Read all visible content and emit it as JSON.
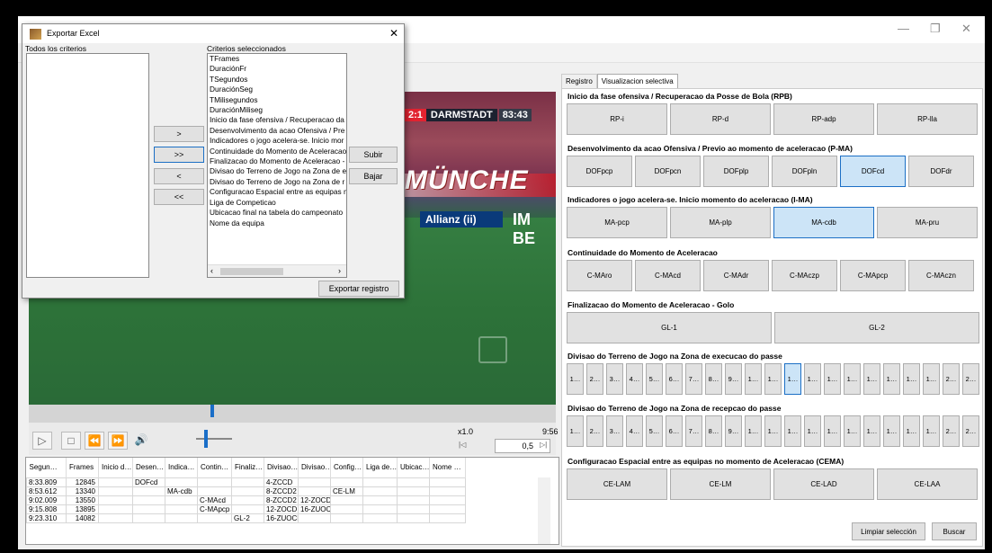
{
  "window": {
    "min_glyph": "—",
    "restore_glyph": "❐",
    "close_glyph": "✕"
  },
  "video": {
    "score": "2:1",
    "team": "DARMSTADT",
    "clock": "83:43",
    "banner": "MÜNCHE",
    "sponsor": "Allianz (ii)",
    "banner2": "IM BE"
  },
  "player": {
    "zoom": "x1.0",
    "time": "9:56",
    "speed_value": "0,5",
    "buttons": [
      "▷",
      "□",
      "⏪",
      "⏩",
      "🔊"
    ]
  },
  "table": {
    "headers": [
      "Segun…",
      "Frames",
      "Inicio d…",
      "Desen…",
      "Indica…",
      "Contin…",
      "Finaliz…",
      "Divisao…",
      "Divisao…",
      "Config…",
      "Liga de…",
      "Ubicac…",
      "Nome …"
    ],
    "rows": [
      [
        "8:33.809",
        "12845",
        "",
        "DOFcd",
        "",
        "",
        "",
        "4-ZCCD",
        "",
        "",
        "",
        "",
        ""
      ],
      [
        "8:53.612",
        "13340",
        "",
        "",
        "MA-cdb",
        "",
        "",
        "8-ZCCD2",
        "",
        "CE-LM",
        "",
        "",
        ""
      ],
      [
        "9:02.009",
        "13550",
        "",
        "",
        "",
        "C-MAcd",
        "",
        "8-ZCCD2",
        "12-ZOCD",
        "",
        "",
        "",
        ""
      ],
      [
        "9:15.808",
        "13895",
        "",
        "",
        "",
        "C-MApcp",
        "",
        "12-ZOCD",
        "16-ZUOCD",
        "",
        "",
        "",
        ""
      ],
      [
        "9:23.310",
        "14082",
        "",
        "",
        "",
        "",
        "GL-2",
        "16-ZUOCD",
        "",
        "",
        "",
        "",
        ""
      ]
    ]
  },
  "tabs": [
    {
      "label": "Registro"
    },
    {
      "label": "Visualizacion selectiva"
    }
  ],
  "sections": {
    "rpb": {
      "title": "Inicio da fase ofensiva / Recuperacao da Posse de Bola (RPB)",
      "buttons": [
        "RP-i",
        "RP-d",
        "RP-adp",
        "RP-lla"
      ]
    },
    "pma": {
      "title": "Desenvolvimento da acao Ofensiva / Previo ao momento de aceleracao (P-MA)",
      "buttons": [
        "DOFpcp",
        "DOFpcn",
        "DOFplp",
        "DOFpln",
        "DOFcd",
        "DOFdr"
      ]
    },
    "ima": {
      "title": "Indicadores o jogo acelera-se. Inicio momento do aceleracao (I-MA)",
      "buttons": [
        "MA-pcp",
        "MA-plp",
        "MA-cdb",
        "MA-pru"
      ]
    },
    "cma": {
      "title": "Continuidade do Momento de Aceleracao",
      "buttons": [
        "C-MAro",
        "C-MAcd",
        "C-MAdr",
        "C-MAczp",
        "C-MApcp",
        "C-MAczn"
      ]
    },
    "gol": {
      "title": "Finalizacao do Momento de Aceleracao - Golo",
      "buttons": [
        "GL-1",
        "GL-2"
      ]
    },
    "zexe": {
      "title": "Divisao do Terreno de Jogo na Zona de execucao do passe",
      "buttons": [
        "1…",
        "2…",
        "3…",
        "4…",
        "5…",
        "6…",
        "7…",
        "8…",
        "9…",
        "1…",
        "1…",
        "1…",
        "1…",
        "1…",
        "1…",
        "1…",
        "1…",
        "1…",
        "1…",
        "2…",
        "2…"
      ]
    },
    "zrec": {
      "title": "Divisao do Terreno de Jogo na Zona de recepcao do passe",
      "buttons": [
        "1…",
        "2…",
        "3…",
        "4…",
        "5…",
        "6…",
        "7…",
        "8…",
        "9…",
        "1…",
        "1…",
        "1…",
        "1…",
        "1…",
        "1…",
        "1…",
        "1…",
        "1…",
        "1…",
        "2…",
        "2…"
      ]
    },
    "cema": {
      "title": "Configuracao Espacial entre as equipas no momento de Aceleracao (CEMA)",
      "buttons": [
        "CE-LAM",
        "CE-LM",
        "CE-LAD",
        "CE-LAA"
      ]
    }
  },
  "footer": {
    "clear_label": "Limpiar selección",
    "search_label": "Buscar"
  },
  "dialog": {
    "title": "Exportar Excel",
    "close_glyph": "✕",
    "left_label": "Todos los criterios",
    "right_label": "Criterios seleccionados",
    "move_buttons": [
      ">",
      ">>",
      "<",
      "<<"
    ],
    "up_label": "Subir",
    "down_label": "Bajar",
    "export_label": "Exportar registro",
    "items": [
      "TFrames",
      "DuraciónFr",
      "TSegundos",
      "DuraciónSeg",
      "TMilisegundos",
      "DuraciónMiliseg",
      "Inicio da fase ofensiva / Recuperacao da",
      "Desenvolvimento da acao Ofensiva / Pre",
      "Indicadores o jogo acelera-se. Inicio mor",
      "Continuidade do Momento de Aceleracao",
      "Finalizacao do Momento de Aceleracao -",
      "Divisao do Terreno de Jogo na Zona de e",
      "Divisao do Terreno de Jogo na Zona de r",
      "Configuracao Espacial entre as equipas n",
      "Liga de Competicao",
      "Ubicacao final na tabela do campeonato",
      "Nome da equipa"
    ]
  }
}
